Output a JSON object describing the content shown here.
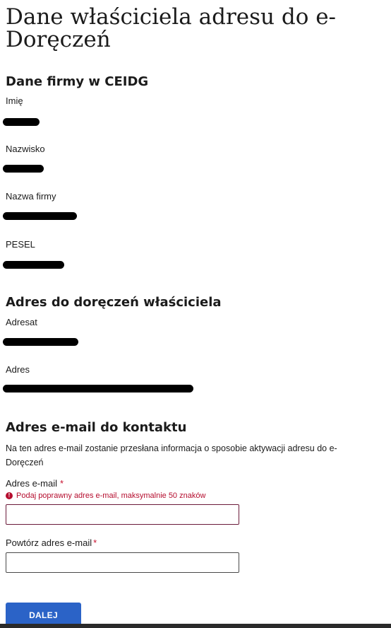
{
  "page": {
    "title": "Dane właściciela adresu do e-Doręczeń"
  },
  "sections": {
    "company": {
      "title": "Dane firmy w CEIDG",
      "fields": {
        "first_name": "Imię",
        "last_name": "Nazwisko",
        "company_name": "Nazwa firmy",
        "pesel": "PESEL"
      }
    },
    "address": {
      "title": "Adres do doręczeń właściciela",
      "fields": {
        "addressee": "Adresat",
        "address": "Adres"
      }
    },
    "email": {
      "title": "Adres e-mail do kontaktu",
      "description": "Na ten adres e-mail zostanie przesłana informacja o sposobie aktywacji adresu do e-Doręczeń",
      "email_label": "Adres e-mail",
      "email_required": "*",
      "email_error": "Podaj poprawny adres e-mail, maksymalnie 50 znaków",
      "email_value": "",
      "repeat_label": "Powtórz adres e-mail",
      "repeat_required": "*",
      "repeat_value": ""
    }
  },
  "actions": {
    "next_label": "DALEJ"
  },
  "icons": {
    "error": "error-circle-icon"
  },
  "colors": {
    "primary": "#2b63c7",
    "error": "#b50d2e",
    "required": "#c8102e"
  }
}
